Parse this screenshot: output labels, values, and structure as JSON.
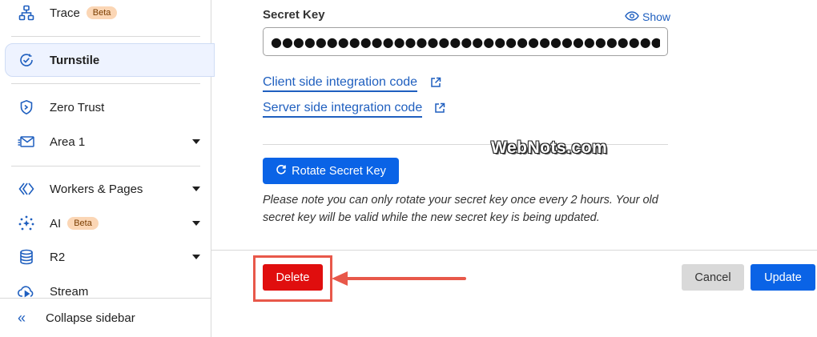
{
  "sidebar": {
    "items": [
      {
        "label": "Trace",
        "badge": "Beta",
        "icon": "sitemap-icon"
      },
      {
        "label": "Turnstile",
        "icon": "turnstile-icon",
        "active": true
      },
      {
        "label": "Zero Trust",
        "icon": "shield-icon"
      },
      {
        "label": "Area 1",
        "icon": "mail-icon",
        "expandable": true
      },
      {
        "label": "Workers & Pages",
        "icon": "workers-icon",
        "expandable": true
      },
      {
        "label": "AI",
        "badge": "Beta",
        "icon": "ai-sparkle-icon",
        "expandable": true
      },
      {
        "label": "R2",
        "icon": "database-icon",
        "expandable": true
      },
      {
        "label": "Stream",
        "icon": "cloud-play-icon"
      }
    ],
    "collapse_label": "Collapse sidebar"
  },
  "secret": {
    "label": "Secret Key",
    "show_label": "Show",
    "value": "●●●●●●●●●●●●●●●●●●●●●●●●●●●●●●●●●●●"
  },
  "links": {
    "client": "Client side integration code",
    "server": "Server side integration code"
  },
  "watermark": "WebNots.com",
  "rotate": {
    "label": "Rotate Secret Key",
    "note": "Please note you can only rotate your secret key once every 2 hours. Your old secret key will be valid while the new secret key is being updated."
  },
  "actions": {
    "delete": "Delete",
    "cancel": "Cancel",
    "update": "Update"
  },
  "colors": {
    "primary": "#0a63e6",
    "danger": "#e00e0e",
    "highlight": "#e8584a",
    "badge_bg": "#fbd6b5"
  }
}
